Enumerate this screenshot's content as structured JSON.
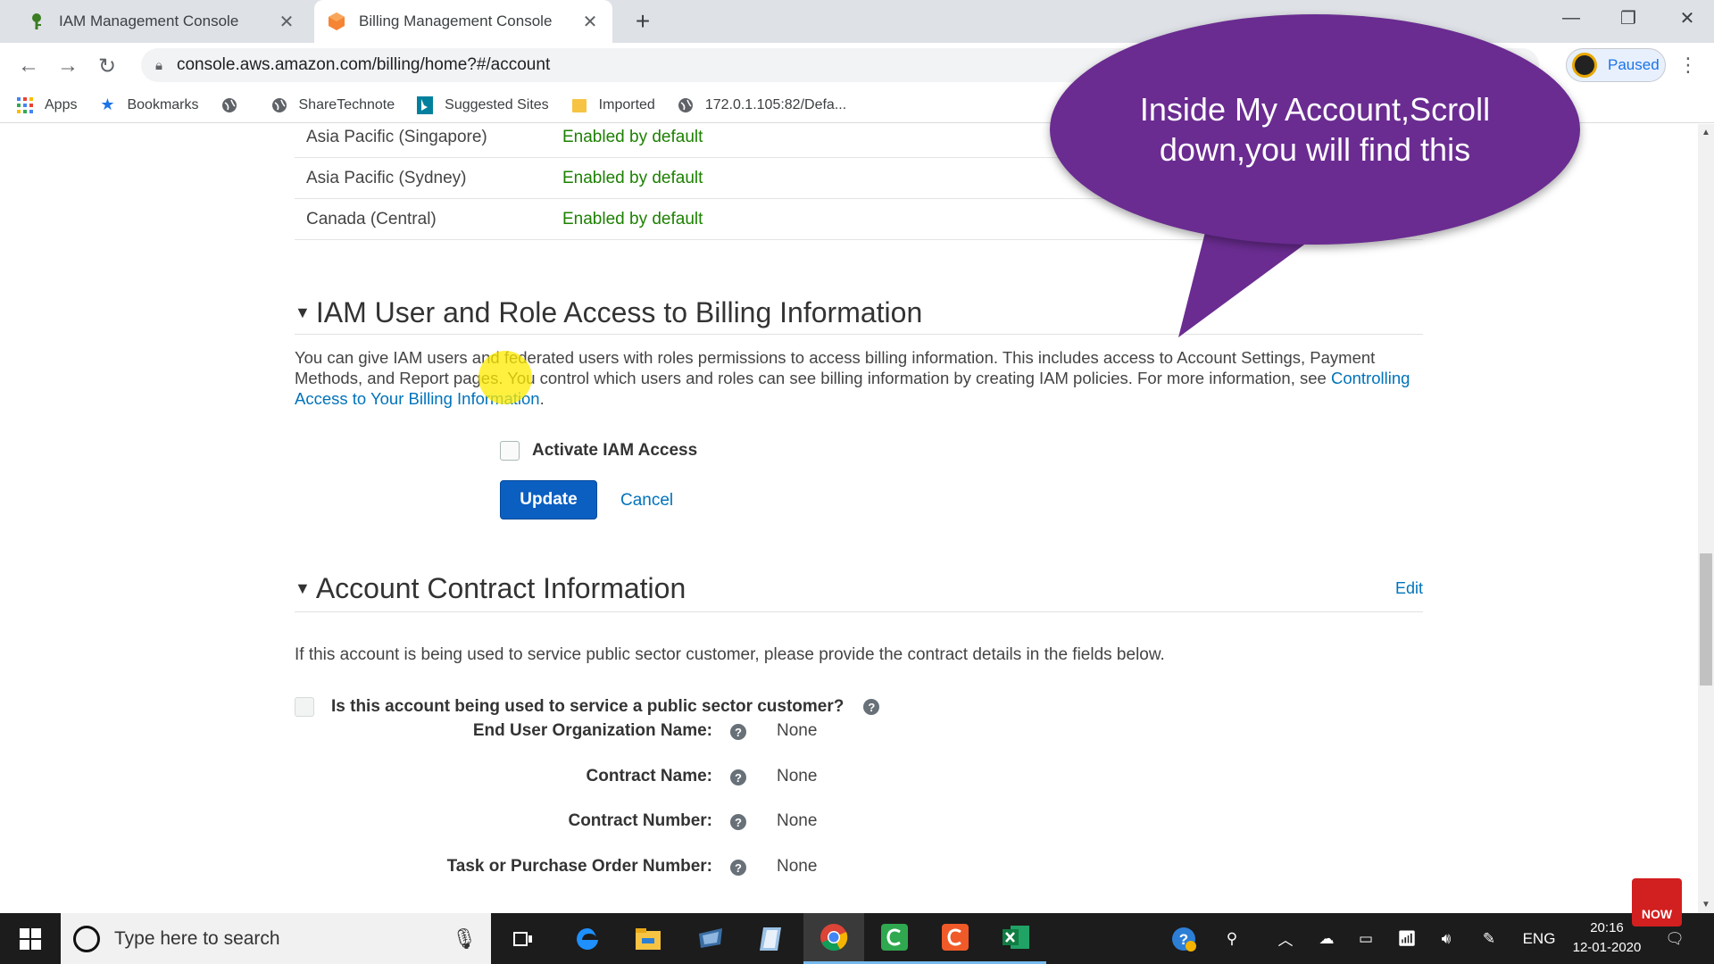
{
  "browser": {
    "tabs": [
      {
        "label": "IAM Management Console",
        "active": false,
        "icon": "iam-icon"
      },
      {
        "label": "Billing Management Console",
        "active": true,
        "icon": "aws-billing-icon"
      }
    ],
    "url": "console.aws.amazon.com/billing/home?#/account",
    "profile_status": "Paused",
    "bookmarks": [
      {
        "label": "Apps",
        "icon": "apps-grid-icon"
      },
      {
        "label": "Bookmarks",
        "icon": "star-icon"
      },
      {
        "label": "",
        "icon": "globe-icon"
      },
      {
        "label": "ShareTechnote",
        "icon": "globe-icon"
      },
      {
        "label": "Suggested Sites",
        "icon": "bing-icon"
      },
      {
        "label": "Imported",
        "icon": "folder-icon"
      },
      {
        "label": "172.0.1.105:82/Defa...",
        "icon": "globe-icon"
      }
    ]
  },
  "page": {
    "regions": [
      {
        "name": "Asia Pacific (Singapore)",
        "status": "Enabled by default"
      },
      {
        "name": "Asia Pacific (Sydney)",
        "status": "Enabled by default"
      },
      {
        "name": "Canada (Central)",
        "status": "Enabled by default"
      }
    ],
    "iam_section": {
      "title": "IAM User and Role Access to Billing Information",
      "description": "You can give IAM users and federated users with roles permissions to access billing information. This includes access to Account Settings, Payment Methods, and Report pages. You control which users and roles can see billing information by creating IAM policies. For more information, see ",
      "link_text": "Controlling Access to Your Billing Information",
      "link_suffix": ".",
      "checkbox_label": "Activate IAM Access",
      "update_label": "Update",
      "cancel_label": "Cancel"
    },
    "contract_section": {
      "title": "Account Contract Information",
      "edit_label": "Edit",
      "description": "If this account is being used to service public sector customer, please provide the contract details in the fields below.",
      "question": "Is this account being used to service a public sector customer?",
      "fields": [
        {
          "label": "End User Organization Name:",
          "value": "None"
        },
        {
          "label": "Contract Name:",
          "value": "None"
        },
        {
          "label": "Contract Number:",
          "value": "None"
        },
        {
          "label": "Task or Purchase Order Number:",
          "value": "None"
        }
      ]
    }
  },
  "callout": {
    "text": "Inside My Account,Scroll down,you will find this",
    "color": "#6a2c91"
  },
  "taskbar": {
    "search_placeholder": "Type here to search",
    "language": "ENG",
    "time": "20:16",
    "date": "12-01-2020"
  },
  "overlay": {
    "subscribe_label": "NOW"
  }
}
